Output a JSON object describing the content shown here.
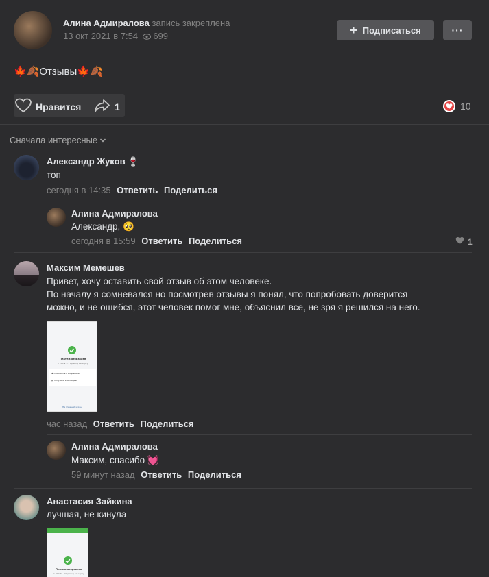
{
  "post": {
    "author": "Алина Адмиралова",
    "pinned": "запись закреплена",
    "date": "13 окт 2021 в 7:54",
    "views": "699",
    "subscribe_label": "Подписаться",
    "more_label": "···",
    "text_emoji_left": "🍁🍂",
    "text": "Отзывы",
    "text_emoji_right": "🍁🍂",
    "like_label": "Нравится",
    "share_count": "1",
    "reactions_count": "10"
  },
  "sort": {
    "label": "Сначала интересные"
  },
  "comments": [
    {
      "author": "Александр Жуков",
      "author_emoji": "🍷",
      "text": "топ",
      "time": "сегодня в 14:35",
      "reply_label": "Ответить",
      "share_label": "Поделиться",
      "replies": [
        {
          "author": "Алина Адмиралова",
          "text": "Александр, 🥺",
          "time": "сегодня в 15:59",
          "reply_label": "Ответить",
          "share_label": "Поделиться",
          "likes": "1"
        }
      ]
    },
    {
      "author": "Максим Мемешев",
      "text_lines": [
        "Привет, хочу оставить свой отзыв об этом человеке.",
        "По началу я сомневался но посмотрев отзывы я понял, что попробовать доверится",
        "можно, и не ошибся, этот человек помог мне, объяснил все, не зря я решился на него."
      ],
      "attachment": {
        "title": "Платеж отправлен",
        "subtitle": "1 200 ₽ — Перевод на карту",
        "row1": "Сохранить в избранное",
        "row2": "Получить квитанцию",
        "footer": "На главный экран"
      },
      "time": "час назад",
      "reply_label": "Ответить",
      "share_label": "Поделиться",
      "replies": [
        {
          "author": "Алина Адмиралова",
          "text": "Максим, спасибо 💓",
          "time": "59 минут назад",
          "reply_label": "Ответить",
          "share_label": "Поделиться"
        }
      ]
    },
    {
      "author": "Анастасия Зайкина",
      "text": "лучшая, не кинула",
      "attachment": {
        "title": "Платеж отправлен",
        "subtitle": "1 200 ₽ — Перевод на карту"
      }
    }
  ],
  "colors": {
    "background": "#2c2c2e",
    "button": "#555558",
    "heart": "#e64646",
    "success": "#4bb34b"
  }
}
